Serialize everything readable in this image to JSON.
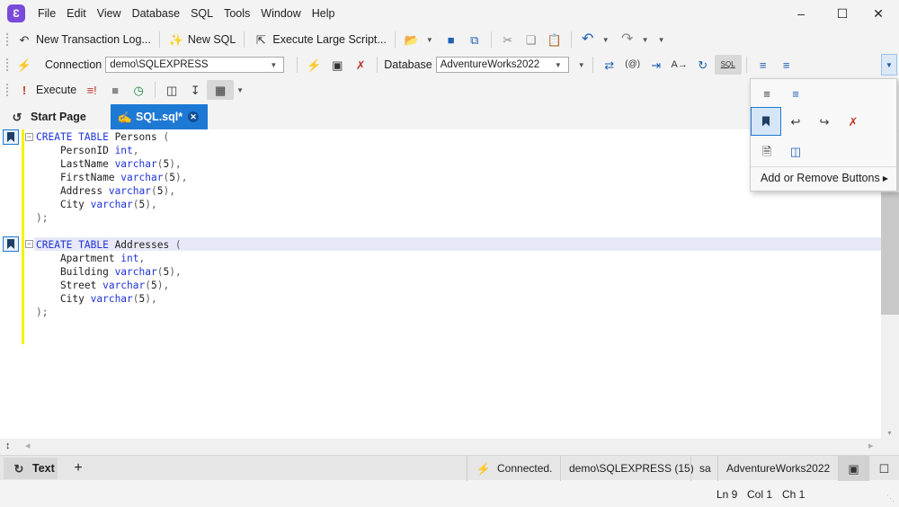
{
  "app": {
    "logo_letter": "Ɛ",
    "menu": [
      "File",
      "Edit",
      "View",
      "Database",
      "SQL",
      "Tools",
      "Window",
      "Help"
    ]
  },
  "toolbar1": {
    "new_transaction_log": "New Transaction Log...",
    "new_sql": "New SQL",
    "execute_large_script": "Execute Large Script..."
  },
  "toolbar2": {
    "connection_label": "Connection",
    "connection_value": "demo\\SQLEXPRESS",
    "database_label": "Database",
    "database_value": "AdventureWorks2022",
    "sql_icon_text": "SQL"
  },
  "toolbar3": {
    "execute_label": "Execute"
  },
  "tabs": [
    {
      "label": "Start Page",
      "active": false
    },
    {
      "label": "SQL.sql*",
      "active": true
    }
  ],
  "editor": {
    "lines": [
      [
        [
          "kw",
          "CREATE TABLE"
        ],
        [
          "id",
          " Persons "
        ],
        [
          "punct",
          "("
        ]
      ],
      [
        [
          "id",
          "    PersonID "
        ],
        [
          "kw",
          "int"
        ],
        [
          "punct",
          ","
        ]
      ],
      [
        [
          "id",
          "    LastName "
        ],
        [
          "kw",
          "varchar"
        ],
        [
          "punct",
          "("
        ],
        [
          "num",
          "5"
        ],
        [
          "punct",
          "),"
        ]
      ],
      [
        [
          "id",
          "    FirstName "
        ],
        [
          "kw",
          "varchar"
        ],
        [
          "punct",
          "("
        ],
        [
          "num",
          "5"
        ],
        [
          "punct",
          "),"
        ]
      ],
      [
        [
          "id",
          "    Address "
        ],
        [
          "kw",
          "varchar"
        ],
        [
          "punct",
          "("
        ],
        [
          "num",
          "5"
        ],
        [
          "punct",
          "),"
        ]
      ],
      [
        [
          "id",
          "    City "
        ],
        [
          "kw",
          "varchar"
        ],
        [
          "punct",
          "("
        ],
        [
          "num",
          "5"
        ],
        [
          "punct",
          "),"
        ]
      ],
      [
        [
          "punct",
          ");"
        ]
      ],
      [],
      [
        [
          "kw",
          "CREATE TABLE"
        ],
        [
          "id",
          " Addresses "
        ],
        [
          "punct",
          "("
        ]
      ],
      [
        [
          "id",
          "    Apartment "
        ],
        [
          "kw",
          "int"
        ],
        [
          "punct",
          ","
        ]
      ],
      [
        [
          "id",
          "    Building "
        ],
        [
          "kw",
          "varchar"
        ],
        [
          "punct",
          "("
        ],
        [
          "num",
          "5"
        ],
        [
          "punct",
          "),"
        ]
      ],
      [
        [
          "id",
          "    Street "
        ],
        [
          "kw",
          "varchar"
        ],
        [
          "punct",
          "("
        ],
        [
          "num",
          "5"
        ],
        [
          "punct",
          "),"
        ]
      ],
      [
        [
          "id",
          "    City "
        ],
        [
          "kw",
          "varchar"
        ],
        [
          "punct",
          "("
        ],
        [
          "num",
          "5"
        ],
        [
          "punct",
          "),"
        ]
      ],
      [
        [
          "punct",
          ");"
        ]
      ]
    ]
  },
  "popup": {
    "add_remove_label": "Add or Remove Buttons"
  },
  "bottom_panel": {
    "text_tab": "Text",
    "add_tab": "+",
    "connection_status": "Connected.",
    "server": "demo\\SQLEXPRESS (15)",
    "user": "sa",
    "database": "AdventureWorks2022"
  },
  "status": {
    "line": "Ln 9",
    "col": "Col 1",
    "ch": "Ch 1"
  },
  "colors": {
    "accent": "#1e79d4",
    "keyword": "#1f35d6",
    "change_bar": "#f4f400"
  }
}
